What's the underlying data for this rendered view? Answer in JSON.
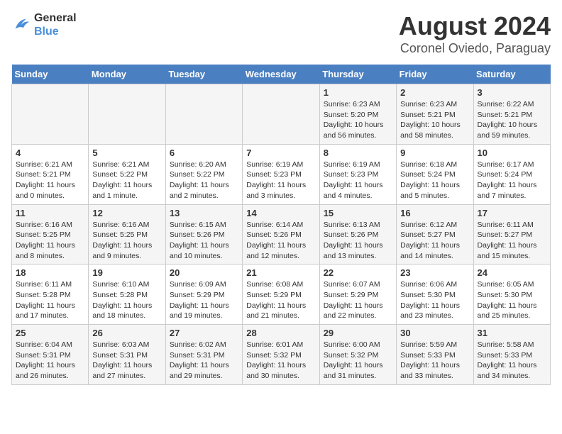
{
  "header": {
    "logo_line1": "General",
    "logo_line2": "Blue",
    "title": "August 2024",
    "subtitle": "Coronel Oviedo, Paraguay"
  },
  "days_of_week": [
    "Sunday",
    "Monday",
    "Tuesday",
    "Wednesday",
    "Thursday",
    "Friday",
    "Saturday"
  ],
  "weeks": [
    [
      {
        "day": "",
        "info": ""
      },
      {
        "day": "",
        "info": ""
      },
      {
        "day": "",
        "info": ""
      },
      {
        "day": "",
        "info": ""
      },
      {
        "day": "1",
        "info": "Sunrise: 6:23 AM\nSunset: 5:20 PM\nDaylight: 10 hours\nand 56 minutes."
      },
      {
        "day": "2",
        "info": "Sunrise: 6:23 AM\nSunset: 5:21 PM\nDaylight: 10 hours\nand 58 minutes."
      },
      {
        "day": "3",
        "info": "Sunrise: 6:22 AM\nSunset: 5:21 PM\nDaylight: 10 hours\nand 59 minutes."
      }
    ],
    [
      {
        "day": "4",
        "info": "Sunrise: 6:21 AM\nSunset: 5:21 PM\nDaylight: 11 hours\nand 0 minutes."
      },
      {
        "day": "5",
        "info": "Sunrise: 6:21 AM\nSunset: 5:22 PM\nDaylight: 11 hours\nand 1 minute."
      },
      {
        "day": "6",
        "info": "Sunrise: 6:20 AM\nSunset: 5:22 PM\nDaylight: 11 hours\nand 2 minutes."
      },
      {
        "day": "7",
        "info": "Sunrise: 6:19 AM\nSunset: 5:23 PM\nDaylight: 11 hours\nand 3 minutes."
      },
      {
        "day": "8",
        "info": "Sunrise: 6:19 AM\nSunset: 5:23 PM\nDaylight: 11 hours\nand 4 minutes."
      },
      {
        "day": "9",
        "info": "Sunrise: 6:18 AM\nSunset: 5:24 PM\nDaylight: 11 hours\nand 5 minutes."
      },
      {
        "day": "10",
        "info": "Sunrise: 6:17 AM\nSunset: 5:24 PM\nDaylight: 11 hours\nand 7 minutes."
      }
    ],
    [
      {
        "day": "11",
        "info": "Sunrise: 6:16 AM\nSunset: 5:25 PM\nDaylight: 11 hours\nand 8 minutes."
      },
      {
        "day": "12",
        "info": "Sunrise: 6:16 AM\nSunset: 5:25 PM\nDaylight: 11 hours\nand 9 minutes."
      },
      {
        "day": "13",
        "info": "Sunrise: 6:15 AM\nSunset: 5:26 PM\nDaylight: 11 hours\nand 10 minutes."
      },
      {
        "day": "14",
        "info": "Sunrise: 6:14 AM\nSunset: 5:26 PM\nDaylight: 11 hours\nand 12 minutes."
      },
      {
        "day": "15",
        "info": "Sunrise: 6:13 AM\nSunset: 5:26 PM\nDaylight: 11 hours\nand 13 minutes."
      },
      {
        "day": "16",
        "info": "Sunrise: 6:12 AM\nSunset: 5:27 PM\nDaylight: 11 hours\nand 14 minutes."
      },
      {
        "day": "17",
        "info": "Sunrise: 6:11 AM\nSunset: 5:27 PM\nDaylight: 11 hours\nand 15 minutes."
      }
    ],
    [
      {
        "day": "18",
        "info": "Sunrise: 6:11 AM\nSunset: 5:28 PM\nDaylight: 11 hours\nand 17 minutes."
      },
      {
        "day": "19",
        "info": "Sunrise: 6:10 AM\nSunset: 5:28 PM\nDaylight: 11 hours\nand 18 minutes."
      },
      {
        "day": "20",
        "info": "Sunrise: 6:09 AM\nSunset: 5:29 PM\nDaylight: 11 hours\nand 19 minutes."
      },
      {
        "day": "21",
        "info": "Sunrise: 6:08 AM\nSunset: 5:29 PM\nDaylight: 11 hours\nand 21 minutes."
      },
      {
        "day": "22",
        "info": "Sunrise: 6:07 AM\nSunset: 5:29 PM\nDaylight: 11 hours\nand 22 minutes."
      },
      {
        "day": "23",
        "info": "Sunrise: 6:06 AM\nSunset: 5:30 PM\nDaylight: 11 hours\nand 23 minutes."
      },
      {
        "day": "24",
        "info": "Sunrise: 6:05 AM\nSunset: 5:30 PM\nDaylight: 11 hours\nand 25 minutes."
      }
    ],
    [
      {
        "day": "25",
        "info": "Sunrise: 6:04 AM\nSunset: 5:31 PM\nDaylight: 11 hours\nand 26 minutes."
      },
      {
        "day": "26",
        "info": "Sunrise: 6:03 AM\nSunset: 5:31 PM\nDaylight: 11 hours\nand 27 minutes."
      },
      {
        "day": "27",
        "info": "Sunrise: 6:02 AM\nSunset: 5:31 PM\nDaylight: 11 hours\nand 29 minutes."
      },
      {
        "day": "28",
        "info": "Sunrise: 6:01 AM\nSunset: 5:32 PM\nDaylight: 11 hours\nand 30 minutes."
      },
      {
        "day": "29",
        "info": "Sunrise: 6:00 AM\nSunset: 5:32 PM\nDaylight: 11 hours\nand 31 minutes."
      },
      {
        "day": "30",
        "info": "Sunrise: 5:59 AM\nSunset: 5:33 PM\nDaylight: 11 hours\nand 33 minutes."
      },
      {
        "day": "31",
        "info": "Sunrise: 5:58 AM\nSunset: 5:33 PM\nDaylight: 11 hours\nand 34 minutes."
      }
    ]
  ]
}
